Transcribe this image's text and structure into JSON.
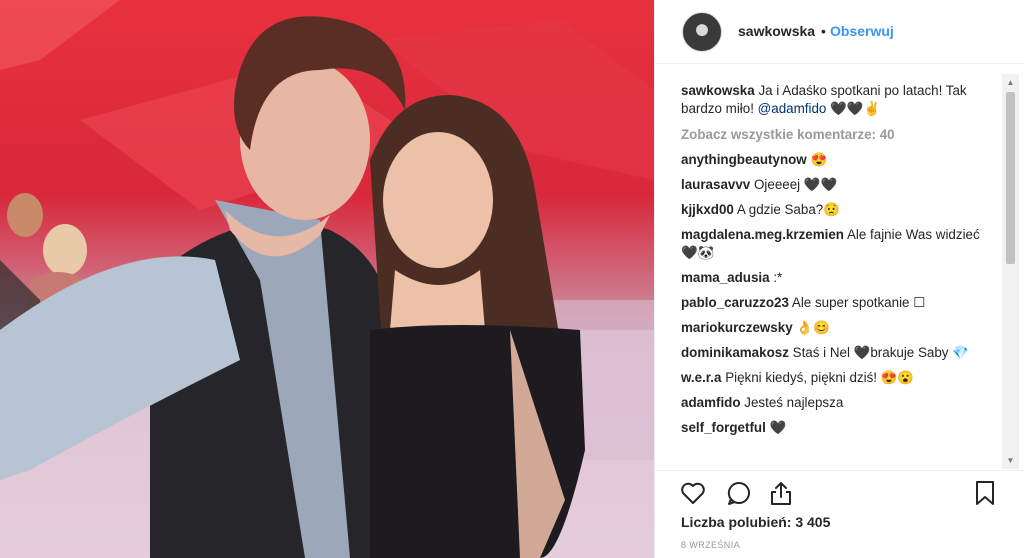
{
  "header": {
    "username": "sawkowska",
    "separator": "•",
    "follow_label": "Obserwuj"
  },
  "caption": {
    "username": "sawkowska",
    "text": "Ja i Adaśko spotkani po latach! Tak bardzo miło!",
    "mention": "@adamfido",
    "emoji": "🖤🖤✌"
  },
  "view_all_label": "Zobacz wszystkie komentarze: 40",
  "comments": [
    {
      "user": "anythingbeautynow",
      "text": "😍"
    },
    {
      "user": "laurasavvv",
      "text": "Ojeeeej 🖤🖤"
    },
    {
      "user": "kjjkxd00",
      "text": "A gdzie Saba?😟"
    },
    {
      "user": "magdalena.meg.krzemien",
      "text": "Ale fajnie Was widzieć 🖤🐼"
    },
    {
      "user": "mama_adusia",
      "text": ":*"
    },
    {
      "user": "pablo_caruzzo23",
      "text": "Ale super spotkanie ☐"
    },
    {
      "user": "mariokurczewsky",
      "text": "👌😊"
    },
    {
      "user": "dominikamakosz",
      "text": "Staś i Nel 🖤brakuje Saby 💎"
    },
    {
      "user": "w.e.r.a",
      "text": "Piękni kiedyś, piękni dziś! 😍😮"
    },
    {
      "user": "adamfido",
      "text": "Jesteś najlepsza"
    },
    {
      "user": "self_forgetful",
      "text": "🖤"
    }
  ],
  "likes_label": "Liczba polubień: 3 405",
  "date_label": "8 WRZEŚNIA",
  "icons": {
    "like": "heart-icon",
    "comment": "comment-icon",
    "share": "share-icon",
    "save": "bookmark-icon"
  },
  "colors": {
    "link": "#3897f0",
    "text": "#262626",
    "muted": "#999999",
    "mention": "#003569"
  }
}
